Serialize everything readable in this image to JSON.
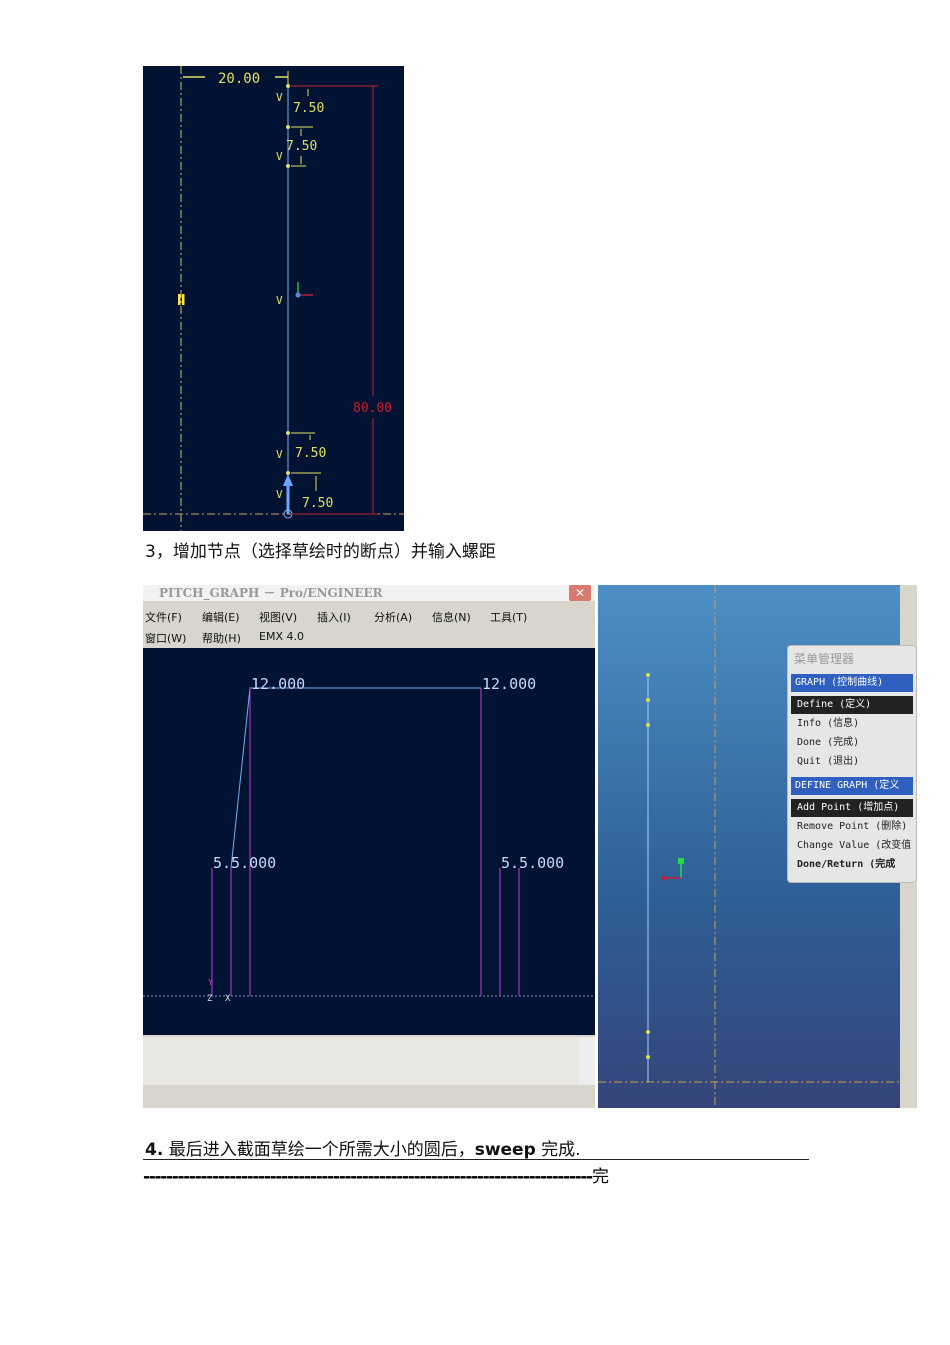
{
  "figure1": {
    "dim_top": "20.00",
    "dim_pitch": [
      "7.50",
      "7.50",
      "7.50",
      "7.50"
    ],
    "dim_height": "80.00",
    "vertex_label": "V"
  },
  "step3": "3，增加节点（选择草绘时的断点）并输入螺距",
  "window": {
    "title": "PITCH_GRAPH － Pro/ENGINEER",
    "close": "✕",
    "menu": [
      "文件(F)",
      "编辑(E)",
      "视图(V)",
      "插入(I)",
      "分析(A)",
      "信息(N)",
      "工具(T)",
      "窗口(W)",
      "帮助(H)",
      "EMX 4.0"
    ],
    "graph_labels": [
      "12.000",
      "12.000",
      "5.5.000",
      "5.5.000"
    ],
    "axis_y": "Y",
    "axis_z": "Z",
    "axis_x": "X"
  },
  "menu_manager": {
    "title": "菜单管理器",
    "graph_header": "GRAPH (控制曲线)",
    "graph_items": [
      "Define (定义)",
      "Info (信息)",
      "Done (完成)",
      "Quit (退出)"
    ],
    "define_header": "DEFINE GRAPH (定义",
    "define_items": [
      "Add Point (增加点)",
      "Remove Point (删除)",
      "Change Value (改变值",
      "Done/Return (完成"
    ]
  },
  "step4": {
    "num": "4.",
    "text": "最后进入截面草绘一个所需大小的圆后，",
    "bold": "sweep",
    "tail": "完成."
  },
  "end_line": "------------------------------------------------------------------------------",
  "end_char": "完"
}
